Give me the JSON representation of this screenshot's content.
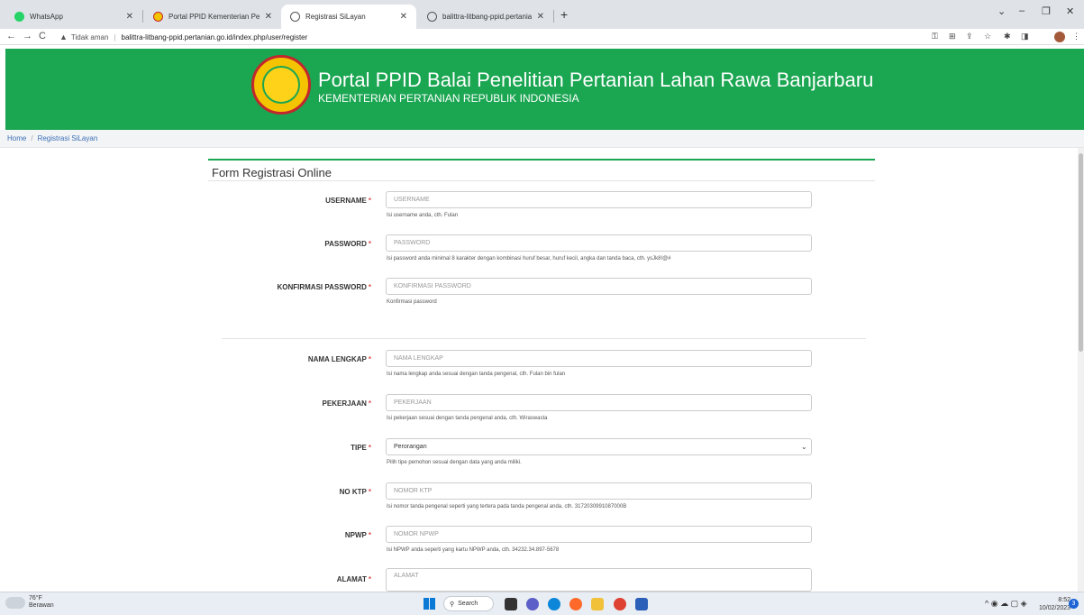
{
  "browser": {
    "tabs": [
      {
        "label": "WhatsApp",
        "icon_color": "#25d366"
      },
      {
        "label": "Portal PPID Kementerian Pertania",
        "icon_color": "#f5c400"
      },
      {
        "label": "Registrasi SiLayan",
        "icon_color": "#666666"
      },
      {
        "label": "balittra-litbang-ppid.pertanian.g",
        "icon_color": "#666666"
      }
    ],
    "new_tab": "+",
    "controls": {
      "down": "⌄",
      "minimize": "–",
      "restore": "❐",
      "close": "✕"
    },
    "address": {
      "back": "←",
      "forward": "→",
      "reload": "C",
      "security_icon": "▲",
      "security_text": "Tidak aman",
      "separator": "|",
      "url": "balittra-litbang-ppid.pertanian.go.id/index.php/user/register"
    },
    "ext_icons": {
      "key": "⚿",
      "translate": "⊞",
      "share": "⇪",
      "bookmark": "☆",
      "extensions": "✱",
      "sidebar": "◨",
      "menu": "⋮"
    }
  },
  "banner": {
    "title": "Portal PPID Balai Penelitian Pertanian Lahan Rawa Banjarbaru",
    "subtitle": "KEMENTERIAN PERTANIAN REPUBLIK INDONESIA"
  },
  "breadcrumb": {
    "home": "Home",
    "separator": "/",
    "current": "Registrasi SiLayan"
  },
  "form": {
    "title": "Form Registrasi Online",
    "required_mark": "*",
    "fields": {
      "username": {
        "label": "USERNAME",
        "placeholder": "USERNAME",
        "help": "Isi username anda, cth. Fulan"
      },
      "password": {
        "label": "PASSWORD",
        "placeholder": "PASSWORD",
        "help": "Isi password anda minimal 8 karakter dengan kombinasi huruf besar, huruf kecil, angka dan tanda baca, cth. ysJk8!@#"
      },
      "confirm": {
        "label": "KONFIRMASI PASSWORD",
        "placeholder": "KONFIRMASI PASSWORD",
        "help": "Konfirmasi password"
      },
      "nama": {
        "label": "NAMA LENGKAP",
        "placeholder": "NAMA LENGKAP",
        "help": "Isi nama lengkap anda sesuai dengan tanda pengenal, cth. Fulan bin fulan"
      },
      "pekerjaan": {
        "label": "PEKERJAAN",
        "placeholder": "PEKERJAAN",
        "help": "Isi pekerjaan sesuai dengan tanda pengenal anda, cth. Wiraswasta"
      },
      "tipe": {
        "label": "TIPE",
        "selected": "Perorangan",
        "help": "Pilih tipe pemohon sesuai dengan data yang anda miliki."
      },
      "ktp": {
        "label": "NO KTP",
        "placeholder": "NOMOR KTP",
        "help": "Isi nomor tanda pengenal seperti yang tertera pada tanda pengenal anda, cth. 3172030991087000B"
      },
      "npwp": {
        "label": "NPWP",
        "placeholder": "NOMOR NPWP",
        "help": "Isi NPWP anda seperti yang kartu NPWP anda, cth. 34232.34.897-5678"
      },
      "alamat": {
        "label": "ALAMAT",
        "placeholder": "ALAMAT"
      }
    }
  },
  "taskbar": {
    "weather_temp": "76°F",
    "weather_desc": "Berawan",
    "search_label": "Search",
    "time": "8:52",
    "date": "10/02/2023",
    "notif_count": "3",
    "tray_icons": "^ ◉ ☁ ▢ ◈"
  }
}
